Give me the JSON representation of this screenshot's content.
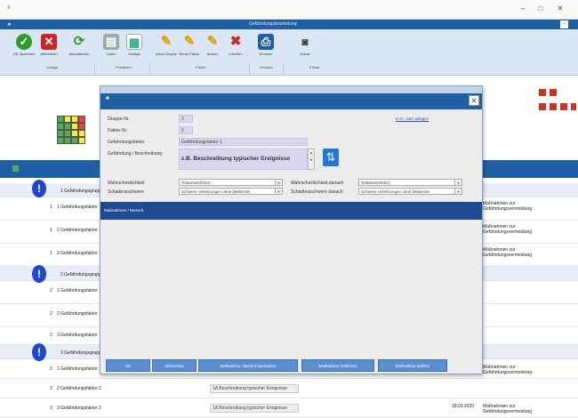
{
  "window": {
    "title": "Gefährdungsbeurteilung",
    "controls": [
      "–",
      "□",
      "✕"
    ]
  },
  "ribbon": {
    "buttons": [
      {
        "label": "OK Speichern",
        "icon": "check-icon"
      },
      {
        "label": "Abbrechen",
        "icon": "cancel-icon"
      },
      {
        "label": "Aktualisieren",
        "icon": "refresh-icon"
      },
      {
        "label": "Laden",
        "icon": "load-icon"
      },
      {
        "label": "Vorlage",
        "icon": "template-icon"
      },
      {
        "label": "Neue Gruppe",
        "icon": "edit-icon"
      },
      {
        "label": "Neuer Faktor",
        "icon": "edit-icon"
      },
      {
        "label": "Ändern",
        "icon": "edit-icon"
      },
      {
        "label": "Löschen",
        "icon": "delete-icon"
      },
      {
        "label": "Drucken",
        "icon": "print-icon"
      },
      {
        "label": "Extras",
        "icon": "camera-icon"
      }
    ],
    "groups": [
      "Vorlage",
      "Positionen",
      "Faktor",
      "Drucken",
      "Extras"
    ]
  },
  "background": {
    "rows": [
      {
        "group": true,
        "num": "",
        "text": "1  Gefährdungsgruppe",
        "right": ""
      },
      {
        "group": false,
        "num": "1",
        "text": "1  Gefährdungsfaktor",
        "right": "Maßnahmen zur Gefährdungsvermeidung"
      },
      {
        "group": false,
        "num": "1",
        "text": "2  Gefährdungsfaktor",
        "right": "Maßnahmen zur Gefährdungsvermeidung"
      },
      {
        "group": false,
        "num": "1",
        "text": "3  Gefährdungsfaktor",
        "right": "Maßnahmen zur Gefährdungsvermeidung"
      },
      {
        "group": true,
        "num": "",
        "text": "2  Gefährdungsgruppe",
        "right": ""
      },
      {
        "group": false,
        "num": "2",
        "text": "1  Gefährdungsfaktor",
        "right": ""
      },
      {
        "group": false,
        "num": "2",
        "text": "2  Gefährdungsfaktor",
        "right": ""
      },
      {
        "group": false,
        "num": "2",
        "text": "3  Gefährdungsfaktor",
        "right": ""
      },
      {
        "group": true,
        "num": "",
        "text": "3  Gefährdungsgruppe",
        "right": ""
      },
      {
        "group": false,
        "num": "3",
        "text": "1  Gefährdungsfaktor",
        "right": "Maßnahmen zur Gefährdungsvermeidung"
      },
      {
        "group": false,
        "num": "3",
        "text": "2  Gefährdungsfaktor 2",
        "right": ""
      },
      {
        "group": false,
        "num": "3",
        "text": "3  Gefährdungsfaktor 3",
        "right": "Maßnahmen zur Gefährdungsvermeidung"
      }
    ],
    "bottom_cells": [
      "1A Beschreibung typischer Ereignisse",
      "1A Beschreibung typischer Ereignisse"
    ],
    "date": "18.03.2020"
  },
  "modal": {
    "gruppe_label": "Gruppe-Nr.",
    "gruppe_value": "1",
    "faktor_label": "Faktor-Nr.",
    "faktor_value": "1",
    "gefaehrdung_label": "Gefährdungsfaktor",
    "gefaehrdung_value": "Gefährdungsfaktor 1",
    "beschreibung_label": "Gefährdung / Beschreibung",
    "beschreibung_value": "z.B. Beschreibung typischer Ereignisse",
    "link_text": "In III. Jahr anlegen",
    "wahrsch_label": "Wahrscheinlichkeit",
    "wahrsch_value": "Teilweise/ehrlich",
    "schaden_label": "Schadensschwere",
    "schaden_value": "Schwere Verletzungen ohne bleibende",
    "wahrsch_danach_label": "Wahrscheinlichkeit danach",
    "wahrsch_danach_value": "Teilweise/ehrlich",
    "schaden_danach_label": "Schadensschwere danach",
    "schaden_danach_value": "Schwere Verletzungen ohne bleibende",
    "section_title": "Maßnahmen / Bereich",
    "buttons": [
      "OK",
      "Abbrechen",
      "Maßnahme / Bericht bearbeiten",
      "Maßnahme entfernen",
      "Maßnahme wählen"
    ]
  },
  "colors": {
    "accent": "#1f5fa5",
    "section": "#1f4a94",
    "button": "#5a8fd0",
    "field": "#d8d5ee"
  }
}
